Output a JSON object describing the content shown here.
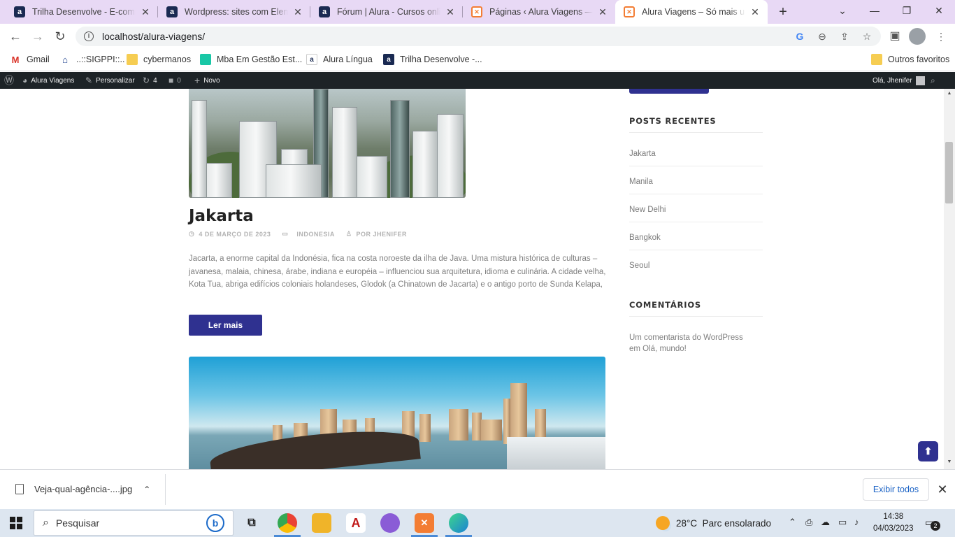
{
  "browser": {
    "tabs": [
      {
        "title": "Trilha Desenvolve - E-commerce",
        "icon": "alura-icon"
      },
      {
        "title": "Wordpress: sites com Elementor",
        "icon": "alura-icon"
      },
      {
        "title": "Fórum | Alura - Cursos online",
        "icon": "alura-icon"
      },
      {
        "title": "Páginas ‹ Alura Viagens — WordPress",
        "icon": "xampp-icon"
      },
      {
        "title": "Alura Viagens – Só mais um site",
        "icon": "xampp-icon",
        "active": true
      }
    ],
    "url": "localhost/alura-viagens/",
    "bookmarks": [
      "Gmail",
      "..::SIGPPI::..",
      "cybermanos",
      "Mba Em Gestão Est...",
      "Alura Língua",
      "Trilha Desenvolve -..."
    ],
    "other_bookmarks": "Outros favoritos"
  },
  "wpbar": {
    "site": "Alura Viagens",
    "customize": "Personalizar",
    "updates": "4",
    "comments": "0",
    "new": "Novo",
    "greeting": "Olá, Jhenifer"
  },
  "post": {
    "title": "Jakarta",
    "date": "4 DE MARÇO DE 2023",
    "category": "INDONESIA",
    "author": "POR JHENIFER",
    "excerpt": "Jacarta, a enorme capital da Indonésia, fica na costa noroeste da ilha de Java. Uma mistura histórica de culturas – javanesa, malaia, chinesa, árabe, indiana e européia – influenciou sua arquitetura, idioma e culinária. A cidade velha, Kota Tua, abriga edifícios coloniais holandeses, Glodok (a Chinatown de Jacarta) e o antigo porto de Sunda Kelapa,",
    "read_more": "Ler mais"
  },
  "sidebar": {
    "recent_title": "POSTS RECENTES",
    "recent_posts": [
      "Jakarta",
      "Manila",
      "New Delhi",
      "Bangkok",
      "Seoul"
    ],
    "comments_title": "COMENTÁRIOS",
    "comment_line1": "Um comentarista do WordPress",
    "comment_line2": "em Olá, mundo!"
  },
  "download": {
    "file": "Veja-qual-agência-....jpg",
    "show_all": "Exibir todos"
  },
  "taskbar": {
    "search": "Pesquisar",
    "weather": "28°C  Parc ensolarado",
    "time": "14:38",
    "date": "04/03/2023",
    "notifications": "2"
  },
  "colors": {
    "accent": "#2f3190",
    "tabstrip": "#e8d9f5",
    "wpbar": "#1d2327"
  }
}
